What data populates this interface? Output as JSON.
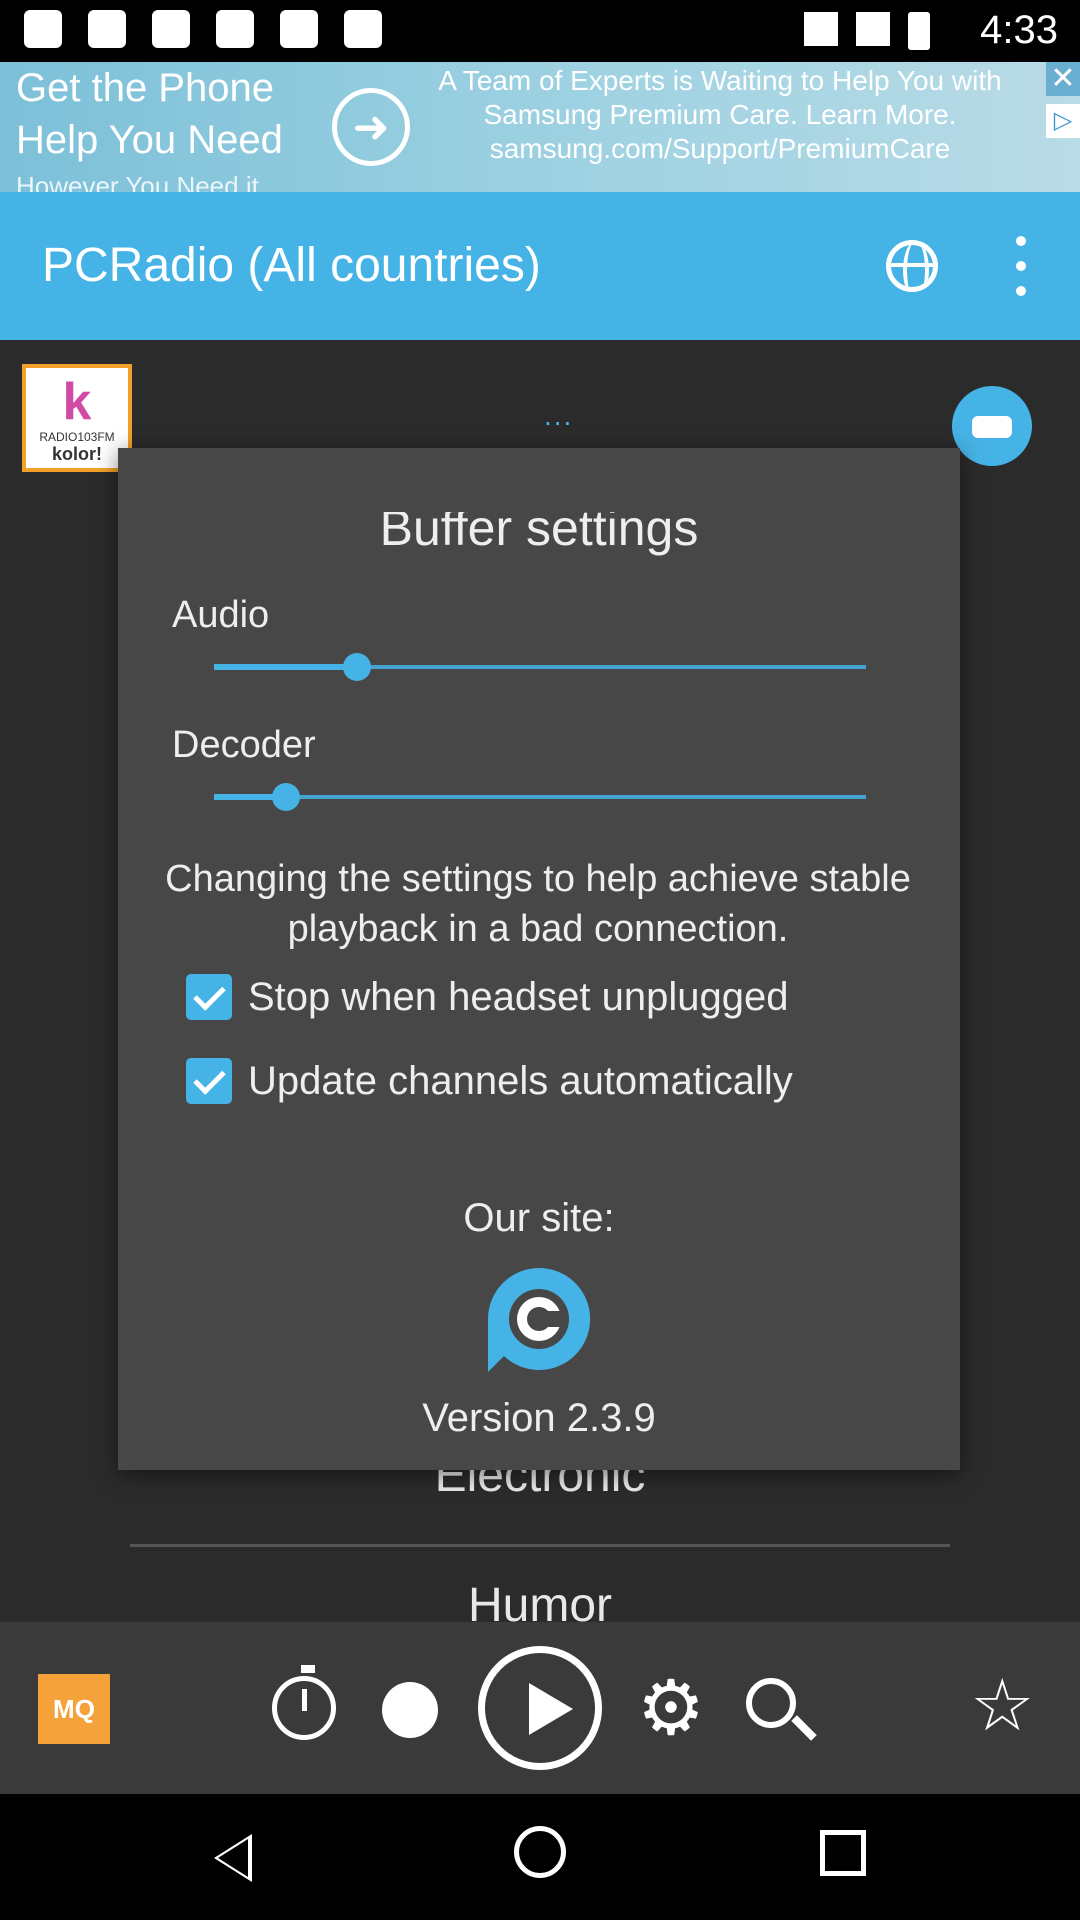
{
  "status_bar": {
    "time": "4:33"
  },
  "ad": {
    "headline_line1": "Get the Phone",
    "headline_line2": "Help You Need",
    "headline_sub": "However You Need it",
    "body": "A Team of Experts is Waiting to Help You with Samsung Premium Care. Learn More.",
    "url": "samsung.com/Support/PremiumCare",
    "close_symbol": "✕",
    "choices_symbol": "▷"
  },
  "app_bar": {
    "title": "PCRadio (All countries)"
  },
  "background": {
    "station_logo_text": "kolor!",
    "station_logo_sub": "RADIO103FM",
    "loading_dots": "...",
    "genres": [
      "Electronic",
      "Humor"
    ]
  },
  "dialog": {
    "title": "Buffer settings",
    "audio_label": "Audio",
    "audio_value": 0.22,
    "decoder_label": "Decoder",
    "decoder_value": 0.11,
    "description": "Changing the settings to help achieve stable playback in a bad connection.",
    "checkboxes": [
      {
        "label": "Stop when headset unplugged",
        "checked": true
      },
      {
        "label": "Update channels automatically",
        "checked": true
      }
    ],
    "site_label": "Our site:",
    "version": "Version 2.3.9"
  },
  "player_bar": {
    "mq_label": "MQ",
    "settings_glyph": "⚙",
    "star_glyph": "☆"
  },
  "colors": {
    "accent": "#46b3e6",
    "dialog_bg": "#474747",
    "page_bg": "#2b2b2b",
    "mq": "#f5a23a"
  }
}
